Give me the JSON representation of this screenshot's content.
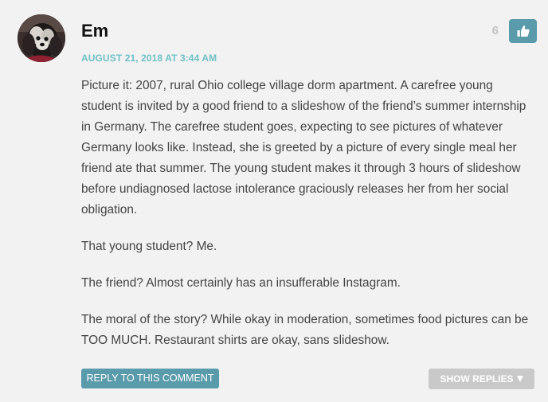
{
  "comment": {
    "author": "Em",
    "timestamp": "AUGUST 21, 2018 AT 3:44 AM",
    "like_count": "6",
    "paragraphs": [
      "Picture it: 2007, rural Ohio college village dorm apartment. A carefree young student is invited by a good friend to a slideshow of the friend’s summer internship in Germany. The carefree student goes, expecting to see pictures of whatever Germany looks like. Instead, she is greeted by a picture of every single meal her friend ate that summer. The young student makes it through 3 hours of slideshow before undiagnosed lactose intolerance graciously releases her from her social obligation.",
      "That young student? Me.",
      "The friend? Almost certainly has an insufferable Instagram.",
      "The moral of the story? While okay in moderation, sometimes food pictures can be TOO MUCH. Restaurant shirts are okay, sans slideshow."
    ],
    "reply_label": "REPLY TO THIS COMMENT",
    "show_replies_label": "SHOW REPLIES",
    "icons": {
      "like": "thumbs-up-icon",
      "show_replies": "caret-down-icon",
      "avatar": "dog-avatar"
    },
    "colors": {
      "accent": "#5a9bab",
      "timestamp": "#6fc1c6",
      "body_text": "#444444",
      "muted_button": "#c9c9c9",
      "background": "#f2f2f2"
    }
  }
}
